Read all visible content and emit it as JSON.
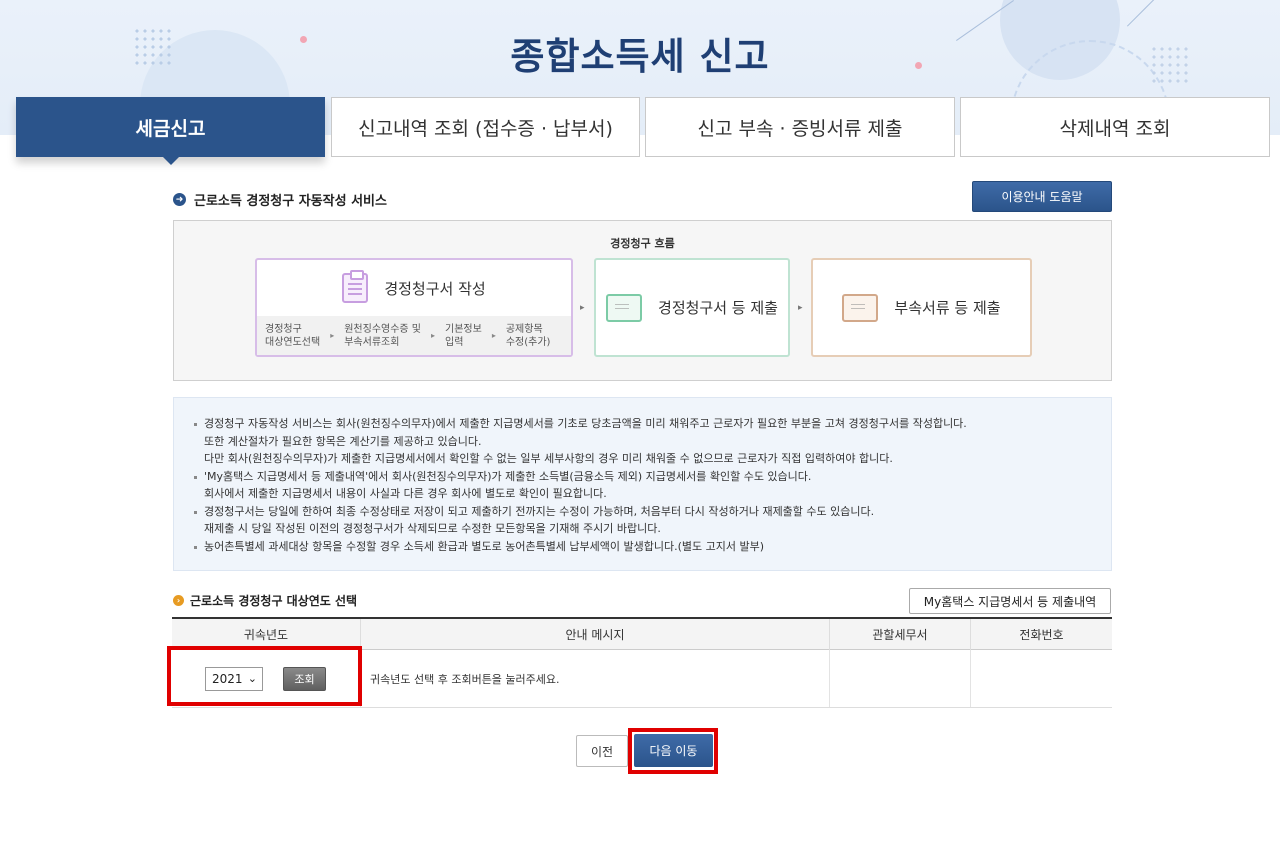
{
  "page_title": "종합소득세 신고",
  "tabs": [
    {
      "label": "세금신고",
      "active": true
    },
    {
      "label": "신고내역 조회 (접수증 · 납부서)",
      "active": false
    },
    {
      "label": "신고 부속 · 증빙서류 제출",
      "active": false
    },
    {
      "label": "삭제내역 조회",
      "active": false
    }
  ],
  "service": {
    "title": "근로소득 경정청구 자동작성 서비스",
    "help_button": "이용안내 도움말"
  },
  "flow": {
    "label": "경정청구 흐름",
    "step1": {
      "title": "경정청구서 작성",
      "substeps": [
        {
          "line1": "경정청구",
          "line2": "대상연도선택"
        },
        {
          "line1": "원천징수영수증 및",
          "line2": "부속서류조회"
        },
        {
          "line1": "기본정보",
          "line2": "입력"
        },
        {
          "line1": "공제항목",
          "line2": "수정(추가)"
        }
      ]
    },
    "step2": {
      "title": "경정청구서 등 제출"
    },
    "step3": {
      "title": "부속서류 등 제출"
    }
  },
  "notice": {
    "items": [
      {
        "lines": [
          "경정청구 자동작성 서비스는 회사(원천징수의무자)에서 제출한 지급명세서를 기초로 당초금액을 미리 채워주고 근로자가 필요한 부분을 고쳐 경정청구서를 작성합니다.",
          "또한 계산절차가 필요한 항목은 계산기를 제공하고 있습니다.",
          "다만 회사(원천징수의무자)가 제출한 지급명세서에서 확인할 수 없는 일부 세부사항의 경우 미리 채워줄 수 없으므로 근로자가 직접 입력하여야 합니다."
        ]
      },
      {
        "lines": [
          "'My홈택스 지급명세서 등 제출내역'에서 회사(원천징수의무자)가 제출한 소득별(금융소득 제외) 지급명세서를 확인할 수도 있습니다.",
          "회사에서 제출한 지급명세서 내용이 사실과 다른 경우 회사에 별도로 확인이 필요합니다."
        ]
      },
      {
        "lines": [
          "경정청구서는 당일에 한하여 최종 수정상태로 저장이 되고 제출하기 전까지는 수정이 가능하며, 처음부터 다시 작성하거나 재제출할 수도 있습니다.",
          "재제출 시 당일 작성된 이전의 경정청구서가 삭제되므로 수정한 모든항목을 기재해 주시기 바랍니다."
        ]
      },
      {
        "lines": [
          "농어촌특별세 과세대상 항목을 수정할 경우 소득세 환급과 별도로 농어촌특별세 납부세액이 발생합니다.(별도 고지서 발부)"
        ]
      }
    ]
  },
  "year_section": {
    "title": "근로소득 경정청구 대상연도 선택",
    "my_button": "My홈택스 지급명세서 등 제출내역"
  },
  "table": {
    "headers": [
      "귀속년도",
      "안내 메시지",
      "관할세무서",
      "전화번호"
    ],
    "row": {
      "year_value": "2021",
      "query_button": "조회",
      "message": "귀속년도 선택 후 조회버튼을 눌러주세요.",
      "tax_office": "",
      "phone": ""
    }
  },
  "nav": {
    "prev": "이전",
    "next": "다음 이동"
  },
  "colors": {
    "primary": "#2b548b",
    "highlight": "#e00000",
    "title": "#1f3f74"
  }
}
